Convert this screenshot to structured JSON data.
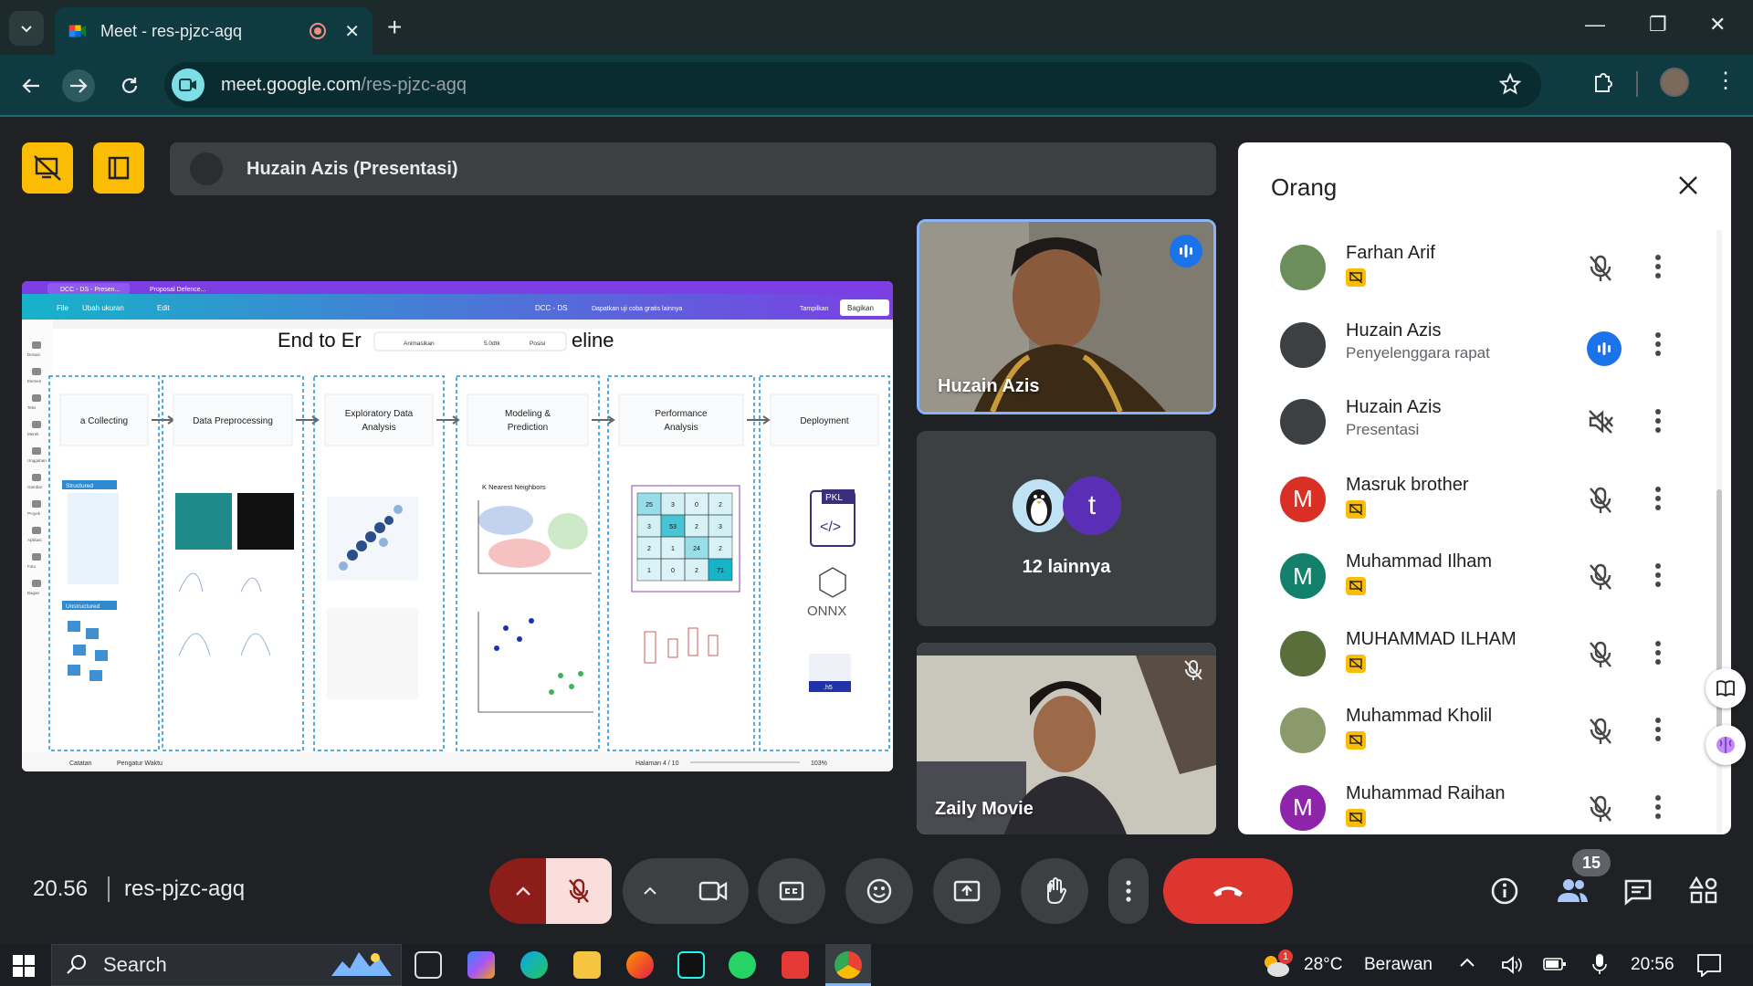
{
  "browser": {
    "tab_title": "Meet - res-pjzc-agq",
    "url_domain": "meet.google.com",
    "url_path": "/res-pjzc-agq"
  },
  "meet": {
    "presenter_bar_label": "Huzain Azis (Presentasi)",
    "tiles": {
      "main_speaker": "Huzain Azis",
      "others_label": "12 lainnya",
      "others_avatar_letter": "t",
      "second_speaker": "Zaily Movie"
    },
    "bottom": {
      "time": "20.56",
      "meeting_code": "res-pjzc-agq",
      "participant_count": "15"
    }
  },
  "people_panel": {
    "title": "Orang",
    "participants": [
      {
        "name": "Farhan Arif",
        "subtitle": "",
        "avatar_letter": "",
        "avatar_color": "#6b8e5a",
        "badge": true,
        "status": "muted"
      },
      {
        "name": "Huzain Azis",
        "subtitle": "Penyelenggara rapat",
        "avatar_letter": "",
        "avatar_color": "#3c4043",
        "badge": false,
        "status": "speaking"
      },
      {
        "name": "Huzain Azis",
        "subtitle": "Presentasi",
        "avatar_letter": "",
        "avatar_color": "#3c4043",
        "badge": false,
        "status": "volume-muted"
      },
      {
        "name": "Masruk brother",
        "subtitle": "",
        "avatar_letter": "M",
        "avatar_color": "#d93025",
        "badge": true,
        "status": "muted"
      },
      {
        "name": "Muhammad Ilham",
        "subtitle": "",
        "avatar_letter": "M",
        "avatar_color": "#12806a",
        "badge": true,
        "status": "muted"
      },
      {
        "name": "MUHAMMAD ILHAM",
        "subtitle": "",
        "avatar_letter": "",
        "avatar_color": "#5a6e3c",
        "badge": true,
        "status": "muted"
      },
      {
        "name": "Muhammad Kholil",
        "subtitle": "",
        "avatar_letter": "",
        "avatar_color": "#8a9a6a",
        "badge": true,
        "status": "muted"
      },
      {
        "name": "Muhammad Raihan",
        "subtitle": "",
        "avatar_letter": "M",
        "avatar_color": "#8e24aa",
        "badge": true,
        "status": "muted"
      }
    ]
  },
  "slide": {
    "editor_tab1": "DCC - DS - Presen...",
    "editor_tab2": "Proposal Defence...",
    "menu_file": "File",
    "menu_resize": "Ubah ukuran",
    "menu_edit": "Edit",
    "doc_name": "DCC - DS",
    "trial_text": "Dapatkan uji coba gratis lainnya",
    "present_label": "Tampilkan",
    "share_label": "Bagikan",
    "title_left": "End to Er",
    "title_right": "eline",
    "toolbar_animate": "Animasikan",
    "toolbar_duration": "5.0dtk",
    "toolbar_position": "Posisi",
    "stages": [
      "a Collecting",
      "Data Preprocessing",
      "Exploratory Data Analysis",
      "Modeling & Prediction",
      "Performance Analysis",
      "Deployment"
    ],
    "structured_label": "Structured",
    "unstructured_label": "Unstructured",
    "knn_title": "K Nearest Neighbors",
    "pkl_label": "PKL",
    "onnx_label": "ONNX",
    "h5_label": ".h5",
    "sidebar_items": [
      "Desain",
      "Elemen",
      "Teks",
      "Merek",
      "Unggahan",
      "Gambar",
      "Proyek",
      "Aplikasi",
      "Foto",
      "Bagan"
    ],
    "notes_label": "Catatan",
    "timer_label": "Pengatur Waktu",
    "page_label": "Halaman 4 / 10",
    "zoom_label": "103%",
    "confusion_matrix": [
      [
        25,
        3,
        0,
        2
      ],
      [
        3,
        53,
        2,
        3
      ],
      [
        2,
        1,
        24,
        2
      ],
      [
        1,
        0,
        2,
        71
      ]
    ]
  },
  "taskbar": {
    "search_label": "Search",
    "temperature": "28°C",
    "weather": "Berawan",
    "time": "20:56",
    "weather_badge": "1"
  }
}
